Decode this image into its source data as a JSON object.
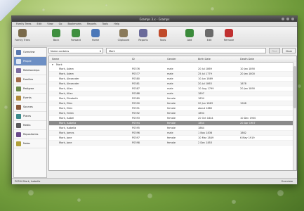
{
  "window": {
    "title": "Gramps 3.x - Gramps"
  },
  "menubar": [
    "Family Trees",
    "Edit",
    "View",
    "Go",
    "Bookmarks",
    "Reports",
    "Tools",
    "Help"
  ],
  "toolbar": [
    {
      "label": "Family Trees",
      "icon": "family-trees-icon",
      "color": "#7a6a4a"
    },
    {
      "label": "Back",
      "icon": "back-arrow-icon",
      "color": "#3f8f3f"
    },
    {
      "label": "Forward",
      "icon": "forward-arrow-icon",
      "color": "#3f8f3f"
    },
    {
      "label": "Home",
      "icon": "home-icon",
      "color": "#4a77b8"
    },
    {
      "label": "Clipboard",
      "icon": "clipboard-icon",
      "color": "#8a7a5a"
    },
    {
      "label": "Reports",
      "icon": "reports-icon",
      "color": "#6a6a9a"
    },
    {
      "label": "Tools",
      "icon": "tools-icon",
      "color": "#c04a2a"
    },
    {
      "label": "Add",
      "icon": "add-icon",
      "color": "#3a8a3a"
    },
    {
      "label": "Edit",
      "icon": "edit-icon",
      "color": "#6a6a6a"
    },
    {
      "label": "Remove",
      "icon": "remove-icon",
      "color": "#c03030"
    }
  ],
  "sidebar": [
    {
      "label": "Overview",
      "icon": "overview-icon",
      "color": "#5a7ab0"
    },
    {
      "label": "People",
      "icon": "people-icon",
      "color": "#4a6aa0",
      "active": true
    },
    {
      "label": "Relationships",
      "icon": "relationships-icon",
      "color": "#7a6aa0"
    },
    {
      "label": "Families",
      "icon": "families-icon",
      "color": "#a06a4a"
    },
    {
      "label": "Pedigree",
      "icon": "pedigree-icon",
      "color": "#6a8a4a"
    },
    {
      "label": "Events",
      "icon": "events-icon",
      "color": "#b08a3a"
    },
    {
      "label": "Sources",
      "icon": "sources-icon",
      "color": "#8a5a3a"
    },
    {
      "label": "Places",
      "icon": "places-icon",
      "color": "#3a8a8a"
    },
    {
      "label": "Media",
      "icon": "media-icon",
      "color": "#5a5a5a"
    },
    {
      "label": "Repositories",
      "icon": "repositories-icon",
      "color": "#6a4a8a"
    },
    {
      "label": "Notes",
      "icon": "notes-icon",
      "color": "#b0a03a"
    }
  ],
  "filter": {
    "combo": "Name contains",
    "search_value": "Mark",
    "find_label": "Find",
    "clear_label": "Clear"
  },
  "table": {
    "columns": [
      "Name",
      "ID",
      "Gender",
      "Birth Date",
      "Death Date"
    ],
    "group": "Mark",
    "rows": [
      [
        "Mark, Adam",
        "P0376",
        "male",
        "20 Jul 1869",
        "10 Jan 1890"
      ],
      [
        "Mark, Adam",
        "P0377",
        "male",
        "25 Jul 1779",
        "20 Jan 1800"
      ],
      [
        "Mark, Alexander",
        "P0380",
        "male",
        "10 Jun 1869",
        ""
      ],
      [
        "Mark, Alexander",
        "P0381",
        "male",
        "20 Jul 1863",
        "1878"
      ],
      [
        "Mark, Allan",
        "P0387",
        "male",
        "10 Aug 1799",
        "20 Jan 1890"
      ],
      [
        "Mark, Allan",
        "P0388",
        "male",
        "1897",
        ""
      ],
      [
        "Mark, Elizabeth",
        "P0389",
        "female",
        "1834",
        ""
      ],
      [
        "Mark, Ellen",
        "P0390",
        "female",
        "20 Jun 1863",
        "1908"
      ],
      [
        "Mark, Ellen",
        "P0391",
        "female",
        "about 1880",
        ""
      ],
      [
        "Mark, Helen",
        "P0392",
        "female",
        "1894",
        ""
      ],
      [
        "Mark, Isabel",
        "P0393",
        "female",
        "20 Oct 1844",
        "10 Dec 1900"
      ],
      [
        "Mark, Isabella",
        "P0394",
        "female",
        "1854",
        "20 Apr 1907"
      ],
      [
        "Mark, Isabella",
        "P0395",
        "female",
        "1864",
        ""
      ],
      [
        "Mark, James",
        "P0396",
        "male",
        "1 Nov 1836",
        "1862"
      ],
      [
        "Mark, Jane",
        "P0397",
        "female",
        "10 Mar 1849",
        "6 May 1919"
      ],
      [
        "Mark, Jane",
        "P0398",
        "female",
        "2 Dec 1853",
        ""
      ]
    ],
    "selected_index": 11
  },
  "status": {
    "left": "P0394 Mark, Isabella",
    "right": "Overview"
  }
}
